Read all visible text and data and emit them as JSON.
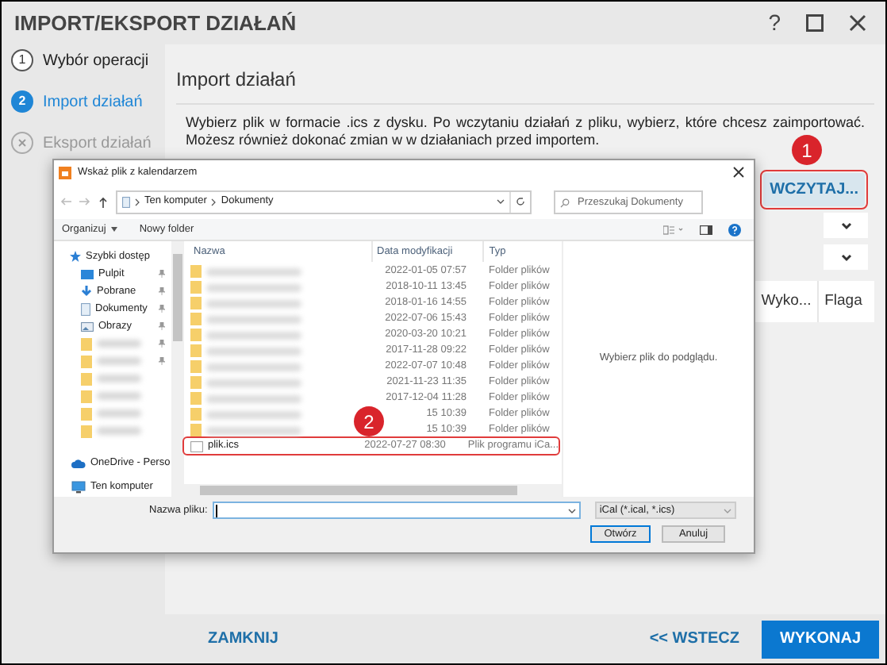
{
  "window": {
    "title": "IMPORT/EKSPORT DZIAŁAŃ",
    "help": "?"
  },
  "steps": [
    {
      "number": "1",
      "label": "Wybór operacji",
      "selected": false,
      "disabled": false
    },
    {
      "number": "2",
      "label": "Import działań",
      "selected": true,
      "disabled": false
    },
    {
      "label": "Eksport działań",
      "selected": false,
      "disabled": true
    }
  ],
  "section_title": "Import działań",
  "description": "Wybierz plik w formacie .ics z dysku. Po wczytaniu działań z pliku, wybierz, które chcesz zaimportować. Możesz również dokonać zmian w w działaniach przed importem.",
  "load_button": "WCZYTAJ...",
  "table": {
    "columns": [
      "Wyko...",
      "Flaga"
    ]
  },
  "annotations": [
    "1",
    "2"
  ],
  "file_dialog": {
    "title": "Wskaż plik z kalendarzem",
    "path": [
      "Ten komputer",
      "Dokumenty"
    ],
    "search_placeholder": "Przeszukaj Dokumenty",
    "toolbar": [
      "Organizuj",
      "Nowy folder"
    ],
    "nav": [
      {
        "kind": "star",
        "label": "Szybki dostęp",
        "pinned": false
      },
      {
        "kind": "desktop",
        "label": "Pulpit",
        "pinned": true
      },
      {
        "kind": "download",
        "label": "Pobrane",
        "pinned": true
      },
      {
        "kind": "document",
        "label": "Dokumenty",
        "pinned": true
      },
      {
        "kind": "pictures",
        "label": "Obrazy",
        "pinned": true
      },
      {
        "kind": "folder",
        "pinned": true
      },
      {
        "kind": "folder",
        "pinned": true
      },
      {
        "kind": "folder",
        "pinned": false
      },
      {
        "kind": "folder",
        "pinned": false
      },
      {
        "kind": "folder",
        "pinned": false
      },
      {
        "kind": "folder",
        "pinned": false
      },
      {
        "kind": "cloud",
        "label": "OneDrive - Perso",
        "pinned": false
      },
      {
        "kind": "computer",
        "label": "Ten komputer",
        "pinned": false
      }
    ],
    "columns": [
      "Nazwa",
      "Data modyfikacji",
      "Typ"
    ],
    "files": [
      {
        "kind": "folder",
        "date": "2022-01-05 07:57",
        "type": "Folder plików",
        "highlighted": false
      },
      {
        "kind": "folder",
        "date": "2018-10-11 13:45",
        "type": "Folder plików",
        "highlighted": false
      },
      {
        "kind": "folder",
        "date": "2018-01-16 14:55",
        "type": "Folder plików",
        "highlighted": false
      },
      {
        "kind": "folder",
        "date": "2022-07-06 15:43",
        "type": "Folder plików",
        "highlighted": false
      },
      {
        "kind": "folder",
        "date": "2020-03-20 10:21",
        "type": "Folder plików",
        "highlighted": false
      },
      {
        "kind": "folder",
        "date": "2017-11-28 09:22",
        "type": "Folder plików",
        "highlighted": false
      },
      {
        "kind": "folder",
        "date": "2022-07-07 10:48",
        "type": "Folder plików",
        "highlighted": false
      },
      {
        "kind": "folder",
        "date": "2021-11-23 11:35",
        "type": "Folder plików",
        "highlighted": false
      },
      {
        "kind": "folder",
        "date": "2017-12-04 11:28",
        "type": "Folder plików",
        "highlighted": false
      },
      {
        "kind": "folder",
        "date": "15 10:39",
        "type": "Folder plików",
        "highlighted": false
      },
      {
        "kind": "folder",
        "date": "15 10:39",
        "type": "Folder plików",
        "highlighted": false
      },
      {
        "kind": "file",
        "name": "plik.ics",
        "date": "2022-07-27 08:30",
        "type": "Plik programu iCa...",
        "highlighted": true
      }
    ],
    "preview": "Wybierz plik do podglądu.",
    "filename_label": "Nazwa pliku:",
    "filter": "iCal (*.ical, *.ics)",
    "buttons": [
      "Otwórz",
      "Anuluj"
    ]
  },
  "footer": {
    "close": "ZAMKNIJ",
    "back": "<< WSTECZ",
    "run": "WYKONAJ"
  }
}
